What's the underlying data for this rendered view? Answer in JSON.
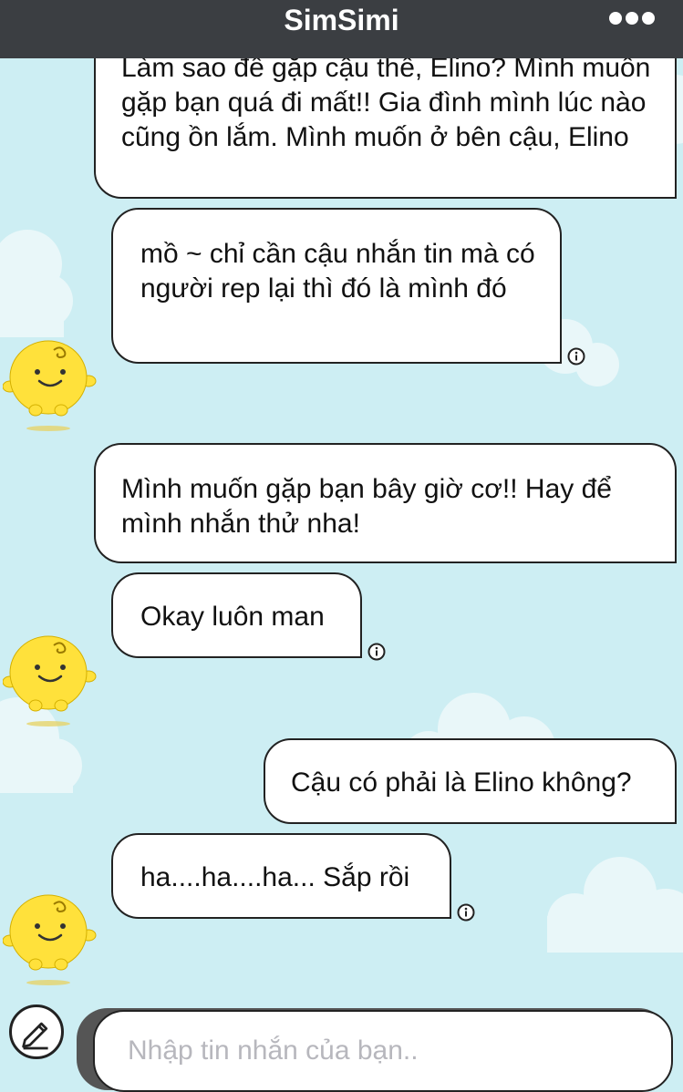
{
  "header": {
    "title": "SimSimi",
    "more_icon": "more-dots-icon"
  },
  "messages": [
    {
      "sender": "user",
      "text": "Làm sao để gặp cậu thế, Elino? Mình muốn gặp bạn quá đi mất!! Gia đình mình lúc nào cũng ồn lắm. Mình muốn ở bên cậu, Elino"
    },
    {
      "sender": "bot",
      "text": "mồ ~ chỉ cần cậu nhắn tin mà có người rep lại thì đó là mình đó"
    },
    {
      "sender": "user",
      "text": "Mình muốn gặp bạn bây giờ cơ!! Hay để mình nhắn thử nha!"
    },
    {
      "sender": "bot",
      "text": "Okay luôn man"
    },
    {
      "sender": "user",
      "text": "Cậu có phải là Elino không?"
    },
    {
      "sender": "bot",
      "text": "ha....ha....ha... Sắp rồi"
    }
  ],
  "composer": {
    "placeholder": "Nhập tin nhắn của bạn..",
    "value": "",
    "edit_icon": "pencil-icon"
  },
  "colors": {
    "background": "#cdeef3",
    "navbar": "#3b3e42",
    "avatar_yellow": "#ffe13b"
  }
}
